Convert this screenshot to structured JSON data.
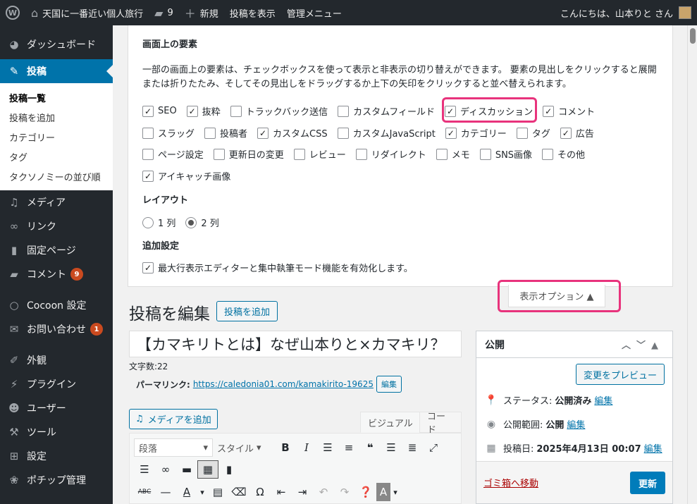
{
  "adminbar": {
    "site_name": "天国に一番近い個人旅行",
    "comments_count": "9",
    "new_label": "新規",
    "view_post": "投稿を表示",
    "admin_menu": "管理メニュー",
    "greeting": "こんにちは、山本りと さん"
  },
  "sidebar": {
    "dashboard": "ダッシュボード",
    "posts": "投稿",
    "sub": [
      "投稿一覧",
      "投稿を追加",
      "カテゴリー",
      "タグ",
      "タクソノミーの並び順"
    ],
    "media": "メディア",
    "links": "リンク",
    "pages": "固定ページ",
    "comments": "コメント",
    "comments_badge": "9",
    "cocoon": "Cocoon 設定",
    "contact": "お問い合わせ",
    "contact_badge": "1",
    "appearance": "外観",
    "plugins": "プラグイン",
    "users": "ユーザー",
    "tools": "ツール",
    "settings": "設定",
    "pochipp": "ポチップ管理"
  },
  "screen_options": {
    "title": "画面上の要素",
    "description": "一部の画面上の要素は、チェックボックスを使って表示と非表示の切り替えができます。 要素の見出しをクリックすると展開または折りたたみ、そしてその見出しをドラッグするか上下の矢印をクリックすると並べ替えられます。",
    "row1": [
      "SEO",
      "抜粋",
      "トラックバック送信",
      "カスタムフィールド",
      "ディスカッション",
      "コメント"
    ],
    "row2": [
      "スラッグ",
      "投稿者",
      "カスタムCSS",
      "カスタムJavaScript",
      "カテゴリー",
      "タグ",
      "広告"
    ],
    "row3": [
      "ページ設定",
      "更新日の変更",
      "レビュー",
      "リダイレクト",
      "メモ",
      "SNS画像",
      "その他"
    ],
    "row4": [
      "アイキャッチ画像"
    ],
    "layout_title": "レイアウト",
    "layout_1": "1 列",
    "layout_2": "2 列",
    "extra_title": "追加設定",
    "extra_option": "最大行表示エディターと集中執筆モード機能を有効化します。",
    "tab_label": "表示オプション ▲"
  },
  "editor": {
    "heading": "投稿を編集",
    "add_new": "投稿を追加",
    "title": "【カマキリトとは】なぜ山本りと×カマキリ？",
    "char_count": "文字数:22",
    "permalink_label": "パーマリンク:",
    "permalink_url": "https://caledonia01.com/kamakirito-19625",
    "edit": "編集",
    "add_media": "メディアを追加",
    "tab_visual": "ビジュアル",
    "tab_code": "コード",
    "format_select": "段落",
    "style_select": "スタイル"
  },
  "publish": {
    "title": "公開",
    "preview": "変更をプレビュー",
    "status_label": "ステータス:",
    "status_value": "公開済み",
    "visibility_label": "公開範囲:",
    "visibility_value": "公開",
    "date_label": "投稿日:",
    "date_value": "2025年4月13日 00:07",
    "edit": "編集",
    "trash": "ゴミ箱へ移動",
    "update": "更新"
  }
}
